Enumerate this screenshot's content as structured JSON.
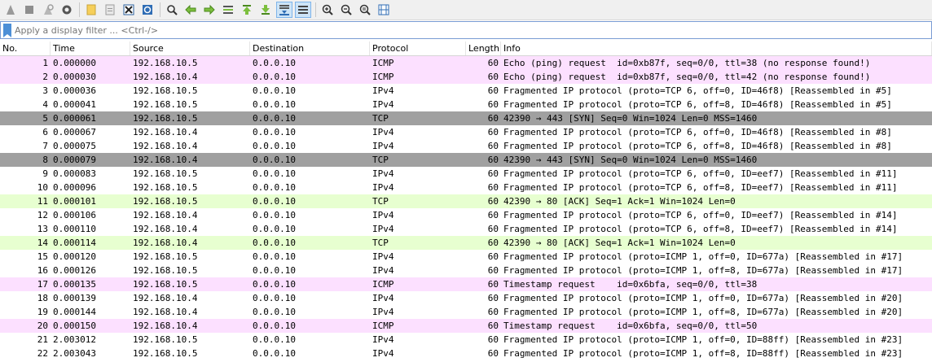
{
  "toolbar": {
    "icons": [
      "shark-fin-start-icon",
      "stop-icon",
      "restart-icon",
      "options-gear-icon",
      "open-folder-icon",
      "file-icon",
      "close-file-icon",
      "reload-icon",
      "find-icon",
      "back-icon",
      "forward-icon",
      "goto-packet-icon",
      "first-packet-icon",
      "last-packet-icon",
      "autoscroll-icon",
      "colorize-icon",
      "zoom-in-icon",
      "zoom-out-icon",
      "normal-size-icon",
      "resize-columns-icon"
    ]
  },
  "filter": {
    "placeholder": "Apply a display filter ... <Ctrl-/>"
  },
  "columns": {
    "no": "No.",
    "time": "Time",
    "source": "Source",
    "destination": "Destination",
    "protocol": "Protocol",
    "length": "Length",
    "info": "Info"
  },
  "colors": {
    "icmp": "#fce0ff",
    "ipv4": "#ffffff",
    "tcp_syn": "#a0a0a0",
    "tcp_ack": "#e7ffd0"
  },
  "packets": [
    {
      "no": "1",
      "time": "0.000000",
      "source": "192.168.10.5",
      "destination": "0.0.0.10",
      "protocol": "ICMP",
      "length": "60",
      "info": "Echo (ping) request  id=0xb87f, seq=0/0, ttl=38 (no response found!)",
      "color": "icmp"
    },
    {
      "no": "2",
      "time": "0.000030",
      "source": "192.168.10.4",
      "destination": "0.0.0.10",
      "protocol": "ICMP",
      "length": "60",
      "info": "Echo (ping) request  id=0xb87f, seq=0/0, ttl=42 (no response found!)",
      "color": "icmp"
    },
    {
      "no": "3",
      "time": "0.000036",
      "source": "192.168.10.5",
      "destination": "0.0.0.10",
      "protocol": "IPv4",
      "length": "60",
      "info": "Fragmented IP protocol (proto=TCP 6, off=0, ID=46f8) [Reassembled in #5]",
      "color": "ipv4"
    },
    {
      "no": "4",
      "time": "0.000041",
      "source": "192.168.10.5",
      "destination": "0.0.0.10",
      "protocol": "IPv4",
      "length": "60",
      "info": "Fragmented IP protocol (proto=TCP 6, off=8, ID=46f8) [Reassembled in #5]",
      "color": "ipv4"
    },
    {
      "no": "5",
      "time": "0.000061",
      "source": "192.168.10.5",
      "destination": "0.0.0.10",
      "protocol": "TCP",
      "length": "60",
      "info": "42390 → 443 [SYN] Seq=0 Win=1024 Len=0 MSS=1460",
      "color": "tcp_syn"
    },
    {
      "no": "6",
      "time": "0.000067",
      "source": "192.168.10.4",
      "destination": "0.0.0.10",
      "protocol": "IPv4",
      "length": "60",
      "info": "Fragmented IP protocol (proto=TCP 6, off=0, ID=46f8) [Reassembled in #8]",
      "color": "ipv4"
    },
    {
      "no": "7",
      "time": "0.000075",
      "source": "192.168.10.4",
      "destination": "0.0.0.10",
      "protocol": "IPv4",
      "length": "60",
      "info": "Fragmented IP protocol (proto=TCP 6, off=8, ID=46f8) [Reassembled in #8]",
      "color": "ipv4"
    },
    {
      "no": "8",
      "time": "0.000079",
      "source": "192.168.10.4",
      "destination": "0.0.0.10",
      "protocol": "TCP",
      "length": "60",
      "info": "42390 → 443 [SYN] Seq=0 Win=1024 Len=0 MSS=1460",
      "color": "tcp_syn"
    },
    {
      "no": "9",
      "time": "0.000083",
      "source": "192.168.10.5",
      "destination": "0.0.0.10",
      "protocol": "IPv4",
      "length": "60",
      "info": "Fragmented IP protocol (proto=TCP 6, off=0, ID=eef7) [Reassembled in #11]",
      "color": "ipv4"
    },
    {
      "no": "10",
      "time": "0.000096",
      "source": "192.168.10.5",
      "destination": "0.0.0.10",
      "protocol": "IPv4",
      "length": "60",
      "info": "Fragmented IP protocol (proto=TCP 6, off=8, ID=eef7) [Reassembled in #11]",
      "color": "ipv4"
    },
    {
      "no": "11",
      "time": "0.000101",
      "source": "192.168.10.5",
      "destination": "0.0.0.10",
      "protocol": "TCP",
      "length": "60",
      "info": "42390 → 80 [ACK] Seq=1 Ack=1 Win=1024 Len=0",
      "color": "tcp_ack"
    },
    {
      "no": "12",
      "time": "0.000106",
      "source": "192.168.10.4",
      "destination": "0.0.0.10",
      "protocol": "IPv4",
      "length": "60",
      "info": "Fragmented IP protocol (proto=TCP 6, off=0, ID=eef7) [Reassembled in #14]",
      "color": "ipv4"
    },
    {
      "no": "13",
      "time": "0.000110",
      "source": "192.168.10.4",
      "destination": "0.0.0.10",
      "protocol": "IPv4",
      "length": "60",
      "info": "Fragmented IP protocol (proto=TCP 6, off=8, ID=eef7) [Reassembled in #14]",
      "color": "ipv4"
    },
    {
      "no": "14",
      "time": "0.000114",
      "source": "192.168.10.4",
      "destination": "0.0.0.10",
      "protocol": "TCP",
      "length": "60",
      "info": "42390 → 80 [ACK] Seq=1 Ack=1 Win=1024 Len=0",
      "color": "tcp_ack"
    },
    {
      "no": "15",
      "time": "0.000120",
      "source": "192.168.10.5",
      "destination": "0.0.0.10",
      "protocol": "IPv4",
      "length": "60",
      "info": "Fragmented IP protocol (proto=ICMP 1, off=0, ID=677a) [Reassembled in #17]",
      "color": "ipv4"
    },
    {
      "no": "16",
      "time": "0.000126",
      "source": "192.168.10.5",
      "destination": "0.0.0.10",
      "protocol": "IPv4",
      "length": "60",
      "info": "Fragmented IP protocol (proto=ICMP 1, off=8, ID=677a) [Reassembled in #17]",
      "color": "ipv4"
    },
    {
      "no": "17",
      "time": "0.000135",
      "source": "192.168.10.5",
      "destination": "0.0.0.10",
      "protocol": "ICMP",
      "length": "60",
      "info": "Timestamp request    id=0x6bfa, seq=0/0, ttl=38",
      "color": "icmp"
    },
    {
      "no": "18",
      "time": "0.000139",
      "source": "192.168.10.4",
      "destination": "0.0.0.10",
      "protocol": "IPv4",
      "length": "60",
      "info": "Fragmented IP protocol (proto=ICMP 1, off=0, ID=677a) [Reassembled in #20]",
      "color": "ipv4"
    },
    {
      "no": "19",
      "time": "0.000144",
      "source": "192.168.10.4",
      "destination": "0.0.0.10",
      "protocol": "IPv4",
      "length": "60",
      "info": "Fragmented IP protocol (proto=ICMP 1, off=8, ID=677a) [Reassembled in #20]",
      "color": "ipv4"
    },
    {
      "no": "20",
      "time": "0.000150",
      "source": "192.168.10.4",
      "destination": "0.0.0.10",
      "protocol": "ICMP",
      "length": "60",
      "info": "Timestamp request    id=0x6bfa, seq=0/0, ttl=50",
      "color": "icmp"
    },
    {
      "no": "21",
      "time": "2.003012",
      "source": "192.168.10.5",
      "destination": "0.0.0.10",
      "protocol": "IPv4",
      "length": "60",
      "info": "Fragmented IP protocol (proto=ICMP 1, off=0, ID=88ff) [Reassembled in #23]",
      "color": "ipv4"
    },
    {
      "no": "22",
      "time": "2.003043",
      "source": "192.168.10.5",
      "destination": "0.0.0.10",
      "protocol": "IPv4",
      "length": "60",
      "info": "Fragmented IP protocol (proto=ICMP 1, off=8, ID=88ff) [Reassembled in #23]",
      "color": "ipv4"
    }
  ]
}
